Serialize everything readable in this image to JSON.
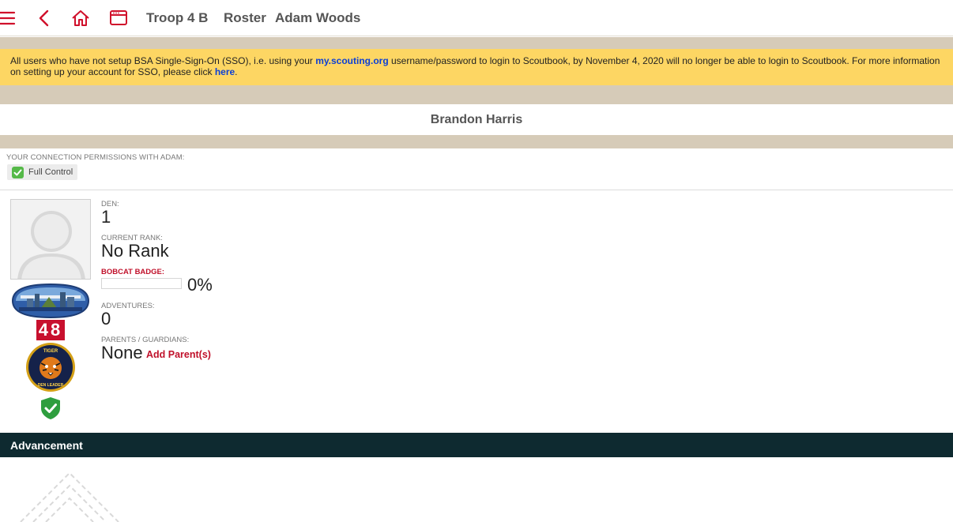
{
  "header": {
    "breadcrumbs": [
      "Troop 4 B",
      "Roster",
      "Adam Woods"
    ],
    "icons": [
      "menu-icon",
      "back-icon",
      "home-icon",
      "browser-window-icon"
    ],
    "accent_color": "#d0102b"
  },
  "notice": {
    "text_1": "All users who have not setup BSA Single-Sign-On (SSO), i.e. using your ",
    "link_1": "my.scouting.org",
    "text_2": " username/password to login to Scoutbook, by November 4, 2020 will no longer be able to login to Scoutbook. For more information on setting up your account for SSO, please click ",
    "link_2": "here",
    "text_3": ".",
    "background_color": "#fdd663"
  },
  "connection_name": "Brandon Harris",
  "permissions": {
    "label": "YOUR CONNECTION PERMISSIONS WITH ADAM:",
    "badge": "Full Control"
  },
  "scout": {
    "unit_number": "48",
    "patch_text_top": "TIGER",
    "patch_text_bottom": "DEN LEADER",
    "den_label": "DEN:",
    "den_value": "1",
    "rank_label": "CURRENT RANK:",
    "rank_value": "No Rank",
    "bobcat_label": "BOBCAT BADGE:",
    "bobcat_progress": 0,
    "bobcat_percent": "0%",
    "adventures_label": "ADVENTURES:",
    "adventures_value": "0",
    "parents_label": "PARENTS / GUARDIANS:",
    "parents_value": "None",
    "add_parent_label": "Add Parent(s)"
  },
  "advancement": {
    "title": "Advancement",
    "bar_color": "#0e2a30"
  }
}
